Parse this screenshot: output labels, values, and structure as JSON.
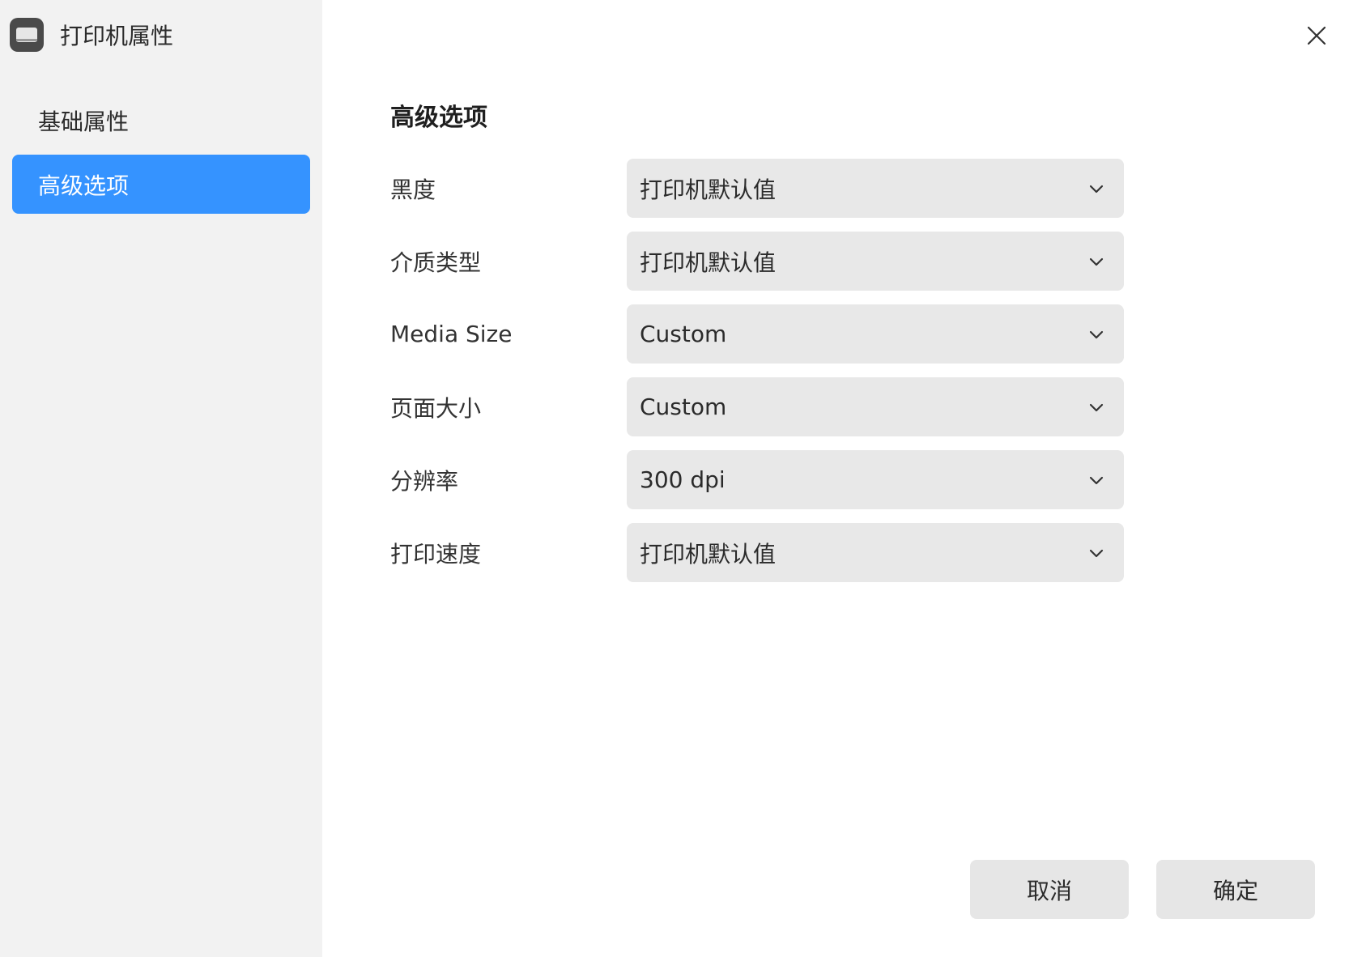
{
  "window": {
    "title": "打印机属性"
  },
  "sidebar": {
    "items": [
      {
        "label": "基础属性",
        "active": false
      },
      {
        "label": "高级选项",
        "active": true
      }
    ]
  },
  "main": {
    "section_title": "高级选项",
    "fields": [
      {
        "label": "黑度",
        "value": "打印机默认值"
      },
      {
        "label": "介质类型",
        "value": "打印机默认值"
      },
      {
        "label": "Media Size",
        "value": "Custom"
      },
      {
        "label": "页面大小",
        "value": "Custom"
      },
      {
        "label": "分辨率",
        "value": "300 dpi"
      },
      {
        "label": "打印速度",
        "value": "打印机默认值"
      }
    ]
  },
  "footer": {
    "cancel_label": "取消",
    "ok_label": "确定"
  },
  "colors": {
    "accent": "#3593ff",
    "sidebar_bg": "#f2f2f2",
    "select_bg": "#e8e8e8"
  },
  "icons": {
    "app": "printer-icon",
    "close": "close-icon",
    "dropdown": "chevron-down-icon"
  }
}
